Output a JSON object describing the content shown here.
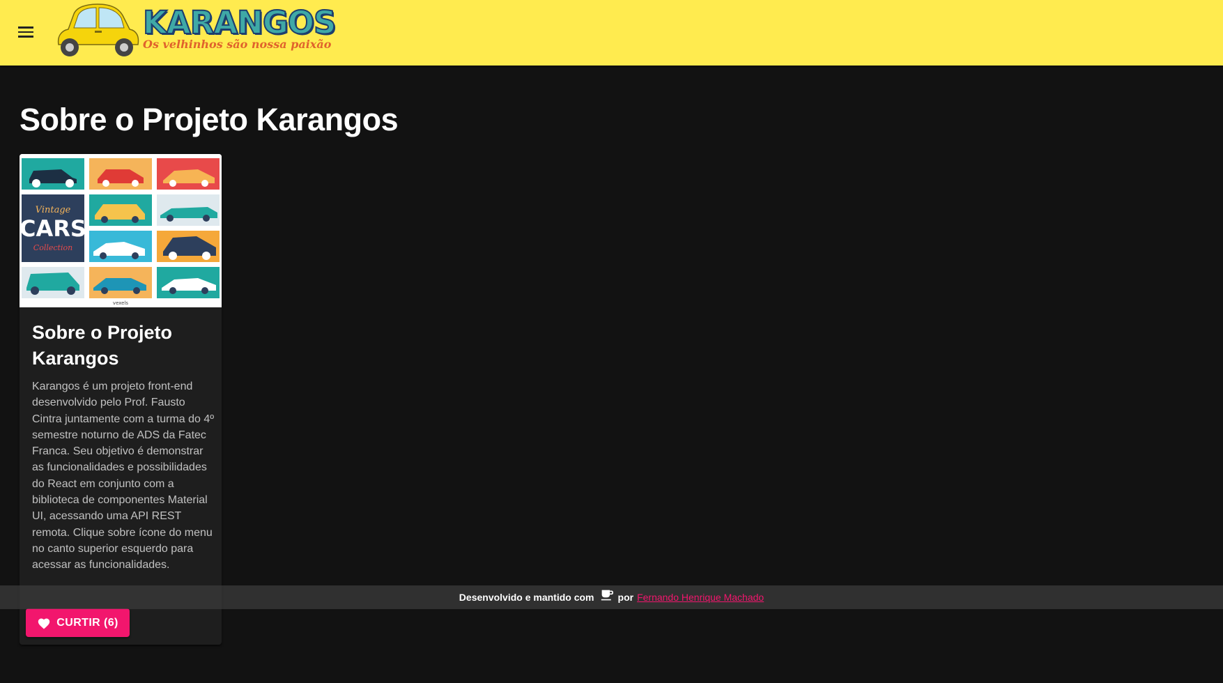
{
  "appbar": {
    "menu_icon": "menu-icon",
    "logo": {
      "title": "KARANGOS",
      "slogan": "Os velhinhos são nossa paixão",
      "car_color": "#f5d40c"
    },
    "background": "#ffeb4f"
  },
  "page": {
    "title": "Sobre o Projeto Karangos"
  },
  "card": {
    "media_poster": {
      "title_top": "Vintage",
      "title_main": "CARS",
      "title_bottom": "Collection",
      "credit": "vexels"
    },
    "title": "Sobre o Projeto Karangos",
    "text": "Karangos é um projeto front-end desenvolvido pelo Prof. Fausto Cintra juntamente com a turma do 4º semestre noturno de ADS da Fatec Franca. Seu objetivo é demonstrar as funcionalidades e possibilidades do React em conjunto com a biblioteca de componentes Material UI, acessando uma API REST remota. Clique sobre ícone do menu no canto superior esquerdo para acessar as funcionalidades.",
    "like_button": {
      "icon": "heart-icon",
      "label": "CURTIR (6)"
    }
  },
  "footer": {
    "text_before": "Desenvolvido e mantido com",
    "icon": "coffee-icon",
    "text_by": "por",
    "author_link": "Fernando Henrique Machado"
  },
  "colors": {
    "background": "#121212",
    "card": "#1e1e1e",
    "accent": "#f2166d"
  }
}
